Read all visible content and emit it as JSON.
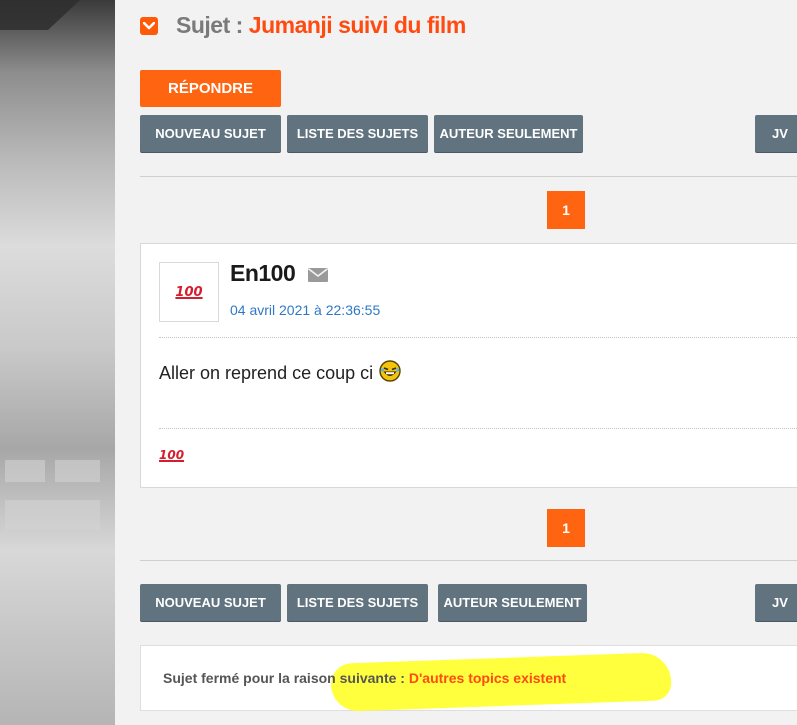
{
  "topic": {
    "prefix": "Sujet :",
    "title": "Jumanji suivi du film"
  },
  "toolbar": {
    "reply_label": "RÉPONDRE",
    "new_topic_label": "NOUVEAU SUJET",
    "topic_list_label": "LISTE DES SUJETS",
    "author_only_label": "AUTEUR SEULEMENT",
    "truncated_label": "JV"
  },
  "pagination": {
    "current_page": "1"
  },
  "post": {
    "author": "En100",
    "date": "04 avril 2021 à 22:36:55",
    "text": "Aller on reprend ce coup ci",
    "avatar_glyph": "100",
    "signature_glyph": "100"
  },
  "closed": {
    "label": "Sujet fermé pour la raison suivante :",
    "reason": "D'autres topics existent"
  },
  "colors": {
    "accent": "#ff6410",
    "title": "#ff4a10",
    "nav_button": "#627380",
    "date_link": "#2f79c4",
    "highlight": "#ffff33"
  },
  "icons": [
    "chevron-down-icon",
    "envelope-icon",
    "laughing-smiley-icon",
    "hundred-points-icon"
  ]
}
